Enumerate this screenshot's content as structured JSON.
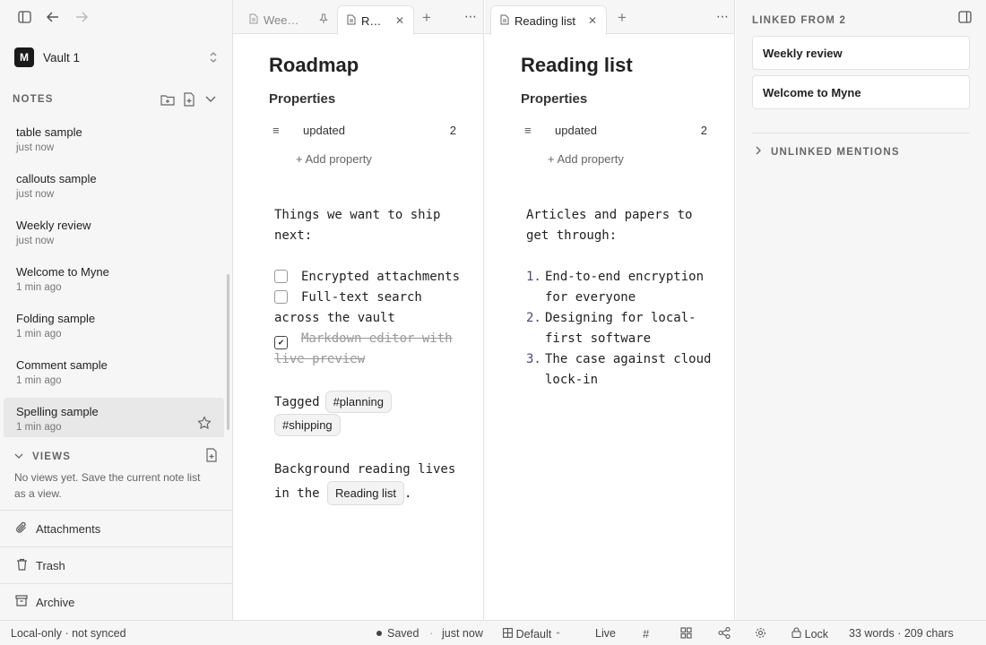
{
  "sidebar": {
    "vault": {
      "initial": "M",
      "name": "Vault 1"
    },
    "notes_header": "NOTES",
    "notes": [
      {
        "title": "table sample",
        "time": "just now"
      },
      {
        "title": "callouts sample",
        "time": "just now"
      },
      {
        "title": "Weekly review",
        "time": "just now"
      },
      {
        "title": "Welcome to Myne",
        "time": "1 min ago"
      },
      {
        "title": "Folding sample",
        "time": "1 min ago"
      },
      {
        "title": "Comment sample",
        "time": "1 min ago"
      },
      {
        "title": "Spelling sample",
        "time": "1 min ago"
      }
    ],
    "views_header": "VIEWS",
    "views_empty": "No views yet. Save the current note list as a view.",
    "attachments": "Attachments",
    "trash": "Trash",
    "archive": "Archive"
  },
  "pane1": {
    "tabs": [
      {
        "label": "Wee…"
      },
      {
        "label": "R…"
      }
    ],
    "title": "Roadmap",
    "properties_label": "Properties",
    "prop_name": "updated",
    "prop_value": "2",
    "add_property": "+ Add property",
    "intro": "Things we want to ship next:",
    "todos": [
      {
        "text": "Encrypted attachments",
        "checked": false
      },
      {
        "text": "Full-text search across the vault",
        "checked": false
      },
      {
        "text": "Markdown editor with live preview",
        "checked": true
      }
    ],
    "tagged_label": "Tagged",
    "tags": [
      "#planning",
      "#shipping"
    ],
    "background_prefix": "Background reading lives in the",
    "link_label": "Reading list",
    "background_suffix": "."
  },
  "pane2": {
    "tab_label": "Reading list",
    "title": "Reading list",
    "properties_label": "Properties",
    "prop_name": "updated",
    "prop_value": "2",
    "add_property": "+ Add property",
    "intro": "Articles and papers to get through:",
    "items": [
      {
        "num": "1.",
        "text": "End-to-end encryption for everyone"
      },
      {
        "num": "2.",
        "text": "Designing for local-first software"
      },
      {
        "num": "3.",
        "text": "The case against cloud lock-in"
      }
    ]
  },
  "right_panel": {
    "linked_header": "LINKED FROM 2",
    "linked": [
      "Weekly review",
      "Welcome to Myne"
    ],
    "unlinked_header": "UNLINKED MENTIONS"
  },
  "statusbar": {
    "sync": "Local-only · not synced",
    "saved": "Saved",
    "sep": "·",
    "saved_time": "just now",
    "layout": "Default",
    "mode": "Live",
    "lock": "Lock",
    "counts": "33 words · 209 chars"
  }
}
